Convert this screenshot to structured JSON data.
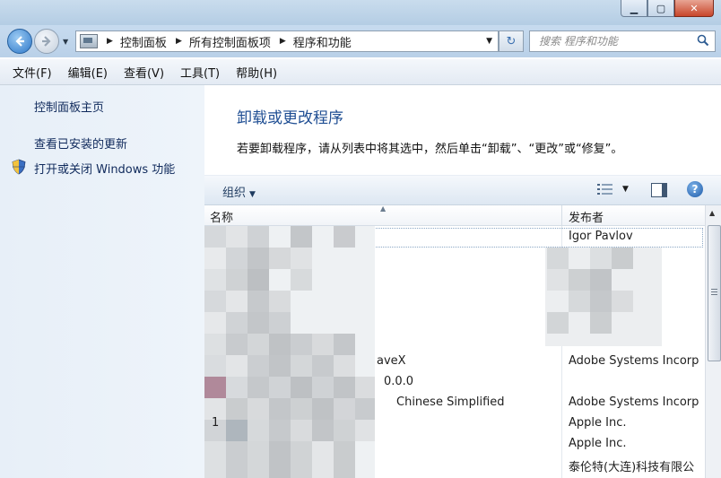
{
  "window": {
    "controls": {
      "minimize": "▁",
      "maximize": "▢",
      "close": "✕"
    }
  },
  "nav": {
    "breadcrumbs": [
      "控制面板",
      "所有控制面板项",
      "程序和功能"
    ],
    "search_placeholder": "搜索 程序和功能"
  },
  "menu": {
    "items": [
      "文件(F)",
      "编辑(E)",
      "查看(V)",
      "工具(T)",
      "帮助(H)"
    ]
  },
  "sidebar": {
    "links": [
      "控制面板主页",
      "查看已安装的更新",
      "打开或关闭 Windows 功能"
    ]
  },
  "main": {
    "title": "卸载或更改程序",
    "description": "若要卸载程序，请从列表中将其选中，然后单击“卸载”、“更改”或“修复”。",
    "toolbar": {
      "organize": "组织",
      "help": "?"
    },
    "columns": {
      "name": "名称",
      "publisher": "发布者"
    },
    "rows": [
      {
        "name": "",
        "publisher": "Igor Pavlov"
      },
      {
        "name": "aveX",
        "publisher": "Adobe Systems Incorp"
      },
      {
        "name": "0.0.0",
        "publisher": ""
      },
      {
        "name": "Chinese Simplified",
        "publisher": "Adobe Systems Incorp"
      },
      {
        "name": "1",
        "publisher": "Apple Inc."
      },
      {
        "name": "",
        "publisher": "Apple Inc."
      },
      {
        "name": "",
        "publisher": "泰伦特(大连)科技有限公"
      }
    ]
  },
  "colors": {
    "heading": "#1f4e93",
    "link": "#102a5c",
    "chrome": "#b9d0e8"
  }
}
